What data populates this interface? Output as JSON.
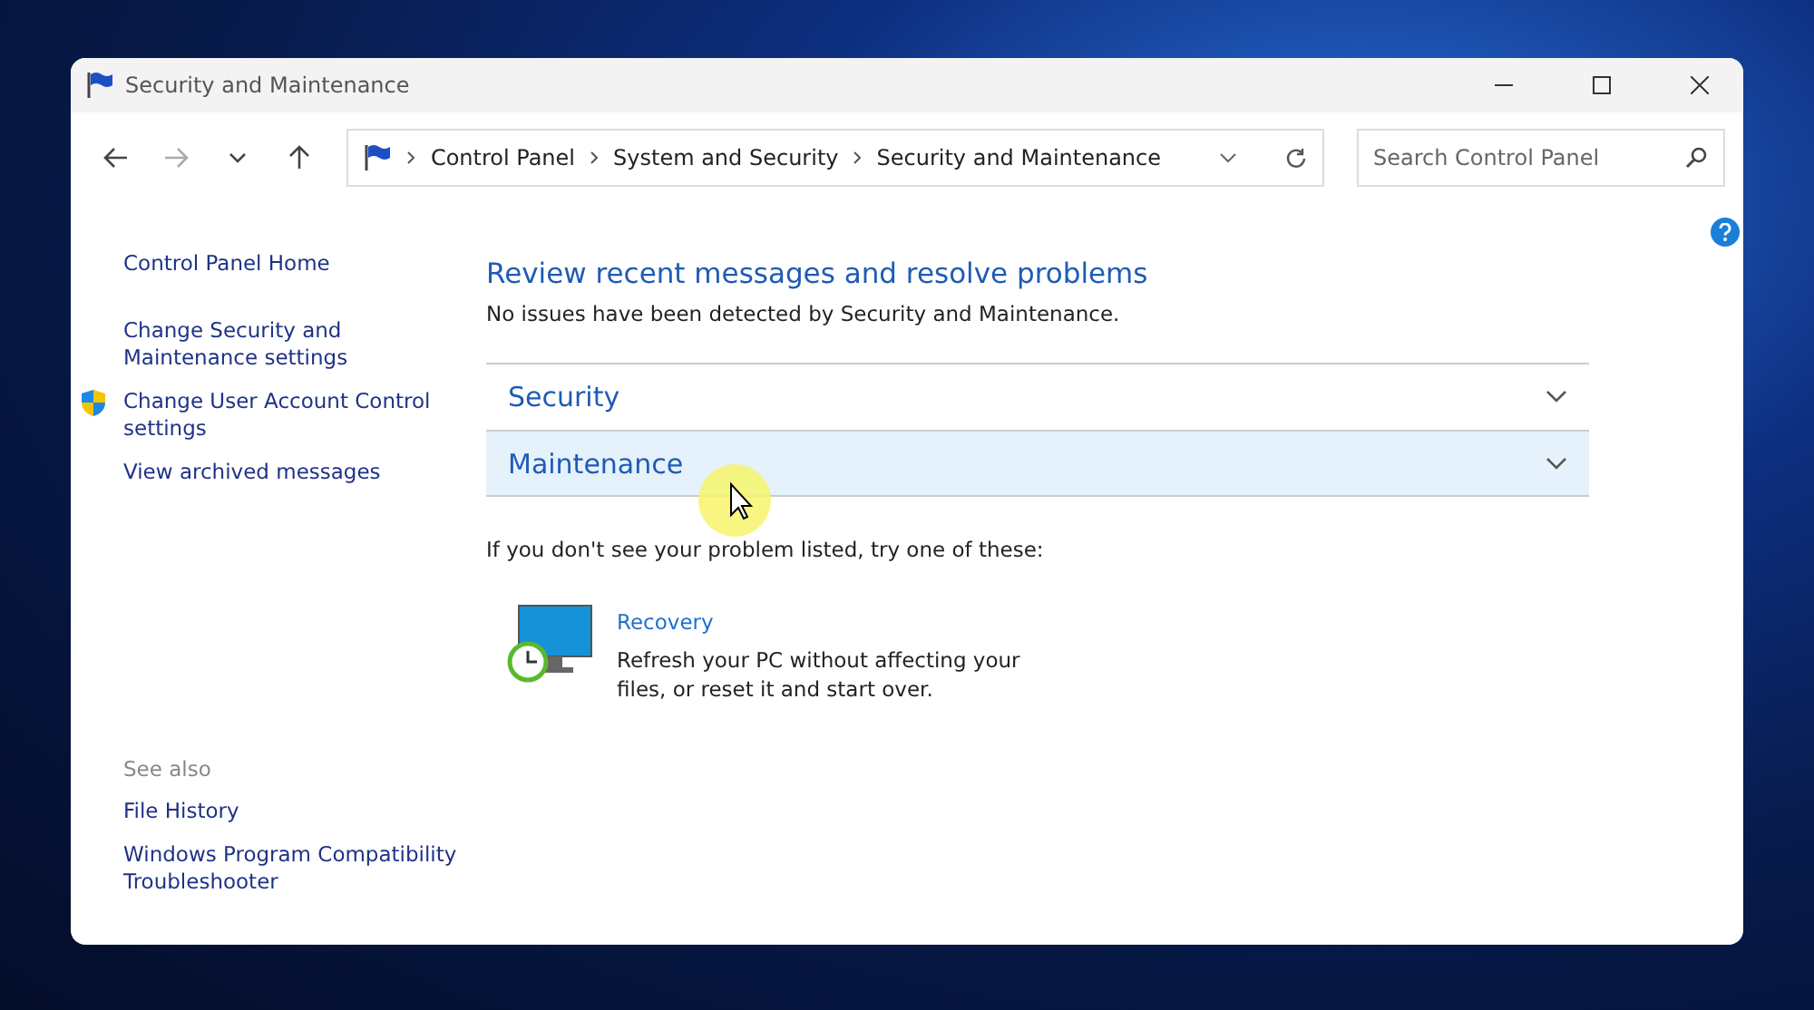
{
  "window": {
    "title": "Security and Maintenance"
  },
  "address_bar": {
    "crumbs": [
      "Control Panel",
      "System and Security",
      "Security and Maintenance"
    ]
  },
  "search": {
    "placeholder": "Search Control Panel"
  },
  "sidebar": {
    "items": [
      {
        "label": "Control Panel Home",
        "shield": false
      },
      {
        "label": "Change Security and Maintenance settings",
        "shield": false
      },
      {
        "label": "Change User Account Control settings",
        "shield": true
      },
      {
        "label": "View archived messages",
        "shield": false
      }
    ],
    "see_also_heading": "See also",
    "see_also": [
      "File History",
      "Windows Program Compatibility Troubleshooter"
    ]
  },
  "content": {
    "heading": "Review recent messages and resolve problems",
    "status": "No issues have been detected by Security and Maintenance.",
    "sections": [
      {
        "label": "Security",
        "expanded": false,
        "highlighted": false
      },
      {
        "label": "Maintenance",
        "expanded": false,
        "highlighted": true
      }
    ],
    "hint": "If you don't see your problem listed, try one of these:",
    "recovery": {
      "title": "Recovery",
      "description": "Refresh your PC without affecting your files, or reset it and start over."
    }
  }
}
